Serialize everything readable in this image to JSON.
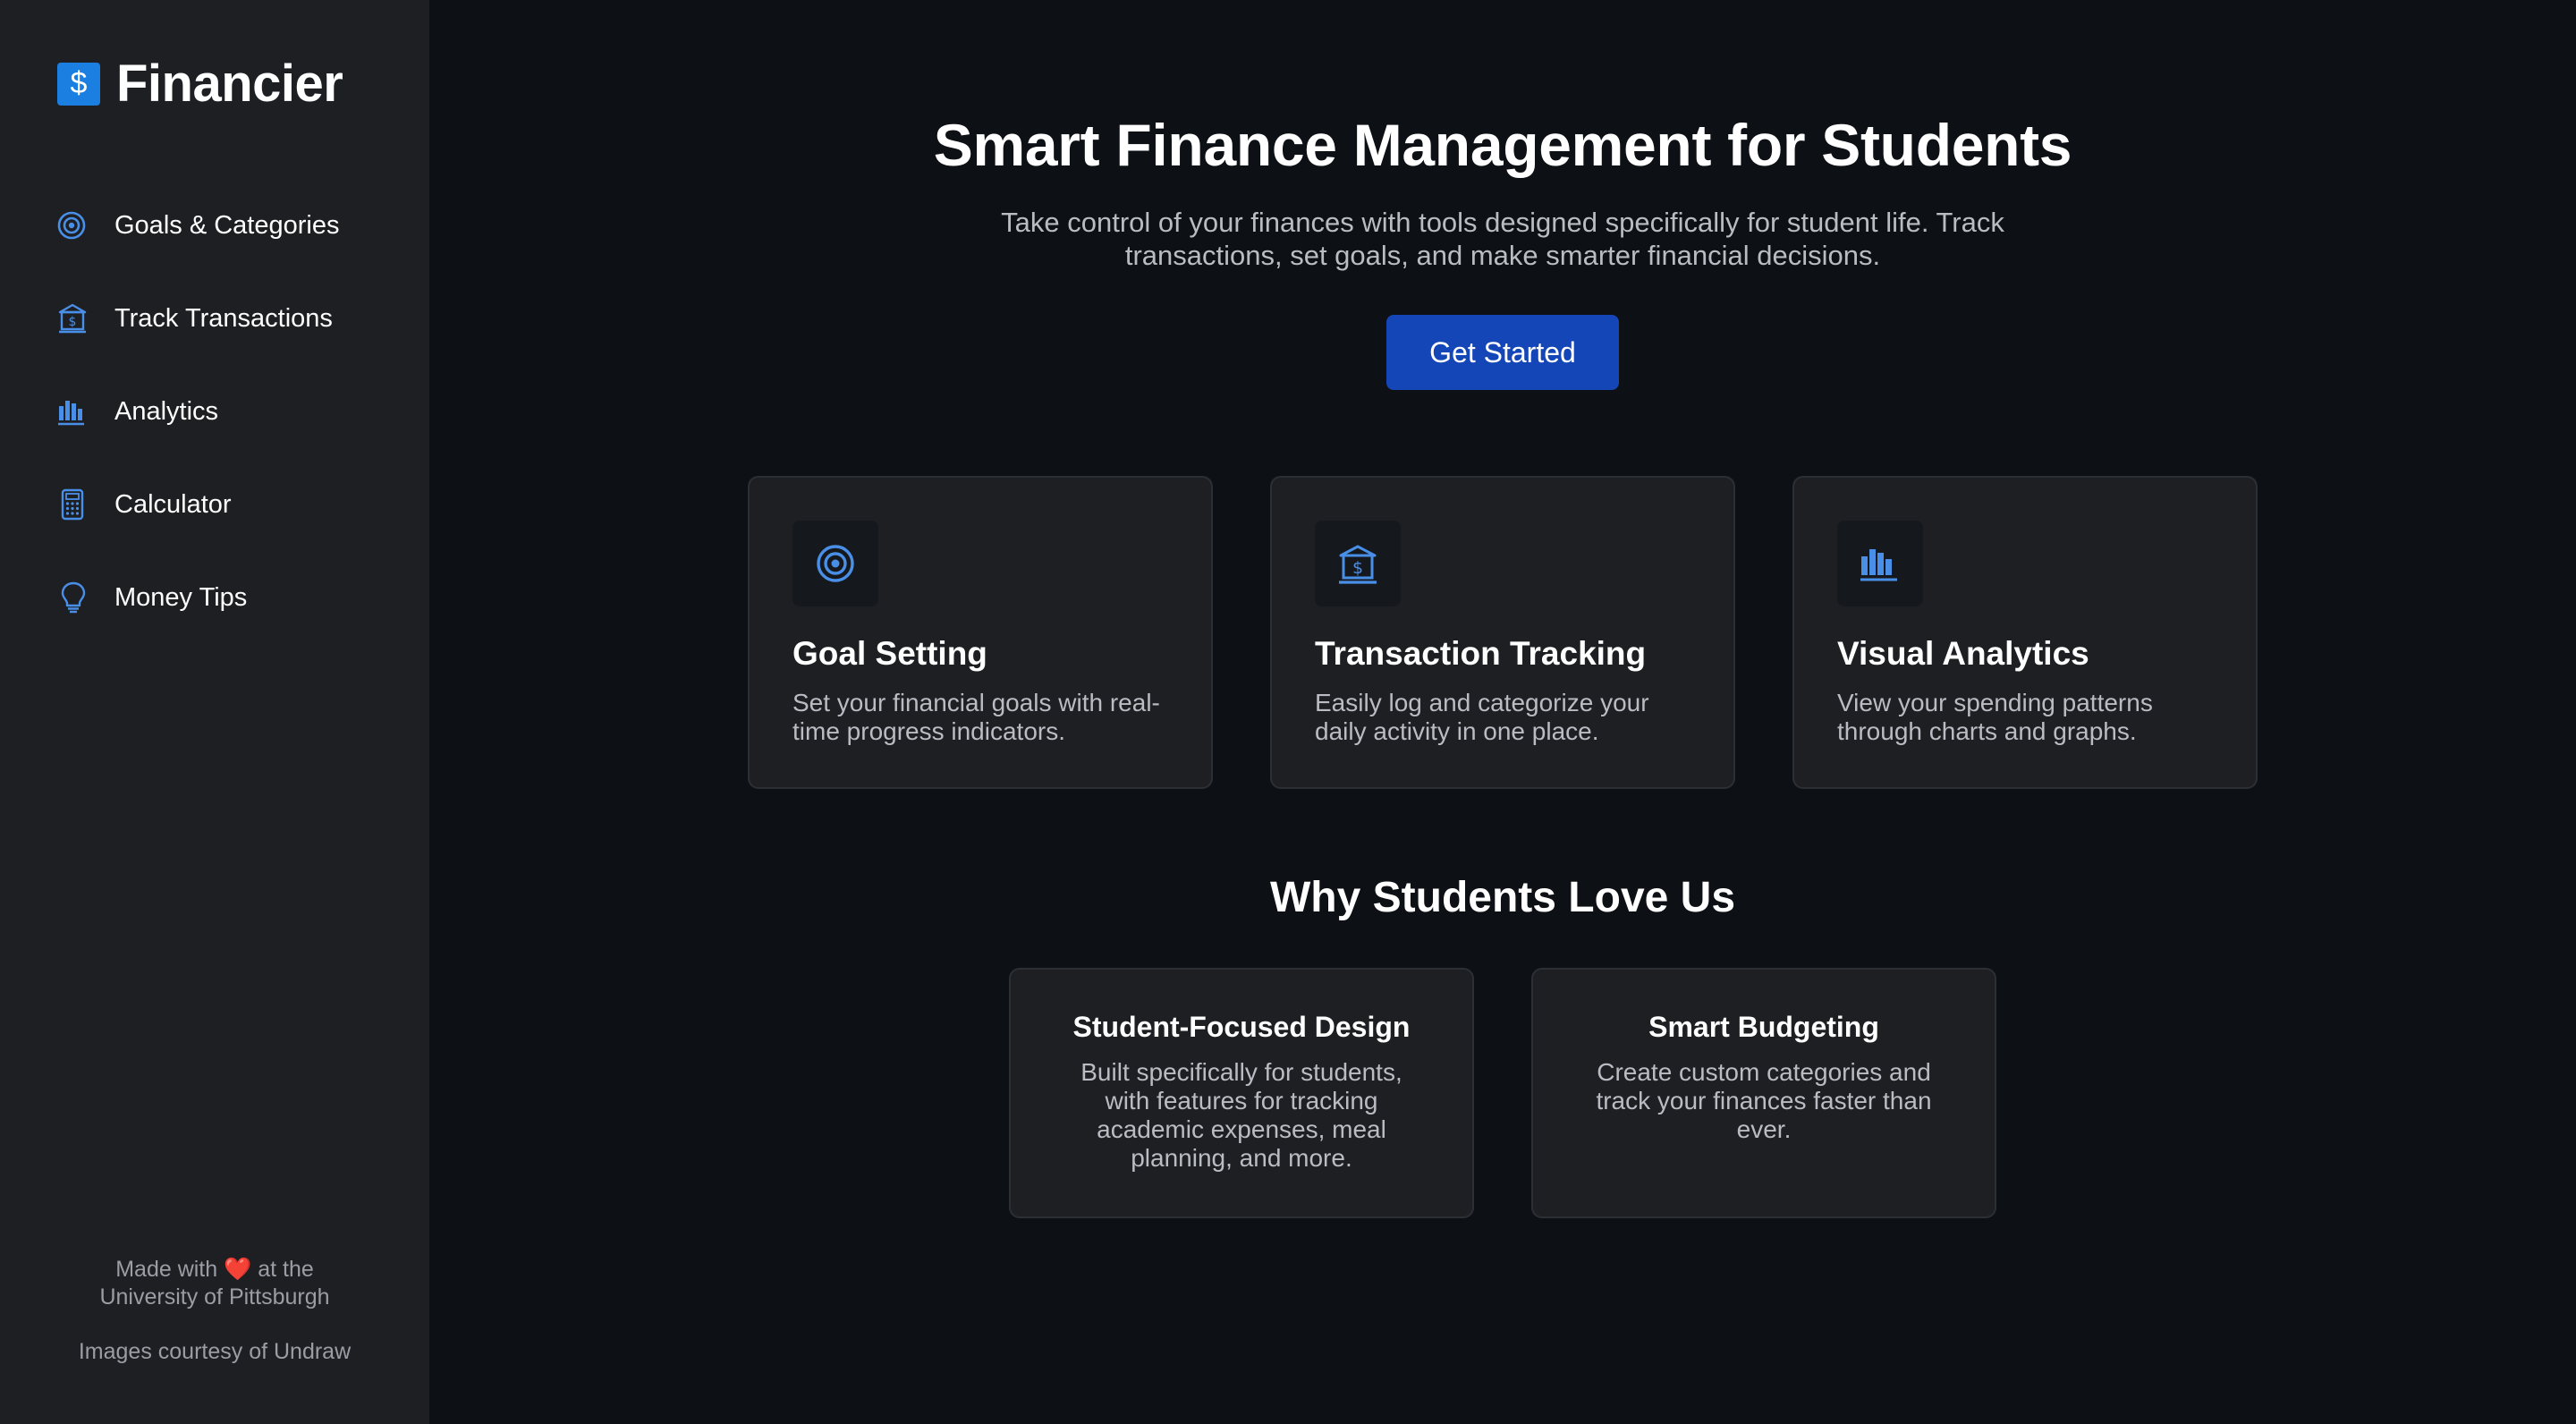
{
  "brand": {
    "name": "Financier",
    "icon": "dollar-icon"
  },
  "colors": {
    "accent": "#1a7fe0",
    "icon_blue": "#4a8fe7",
    "cta": "#1446b8",
    "sidebar_bg": "#1d1f23",
    "main_bg": "#0d1014",
    "card_bg": "#1d1f23",
    "muted_text": "#b9bcc2"
  },
  "sidebar": {
    "items": [
      {
        "label": "Goals & Categories",
        "icon": "target-icon"
      },
      {
        "label": "Track Transactions",
        "icon": "bank-icon"
      },
      {
        "label": "Analytics",
        "icon": "bar-chart-icon"
      },
      {
        "label": "Calculator",
        "icon": "calculator-icon"
      },
      {
        "label": "Money Tips",
        "icon": "lightbulb-icon"
      }
    ],
    "footer": {
      "made_with_prefix": "Made with",
      "heart": "❤️",
      "made_with_suffix": "at the",
      "university": "University of Pittsburgh",
      "credit": "Images courtesy of Undraw"
    }
  },
  "hero": {
    "title": "Smart Finance Management for Students",
    "subtitle": "Take control of your finances with tools designed specifically for student life. Track transactions, set goals, and make smarter financial decisions.",
    "cta_label": "Get Started"
  },
  "features": [
    {
      "title": "Goal Setting",
      "description": "Set your financial goals with real-time progress indicators.",
      "icon": "target-icon"
    },
    {
      "title": "Transaction Tracking",
      "description": "Easily log and categorize your daily activity in one place.",
      "icon": "bank-icon"
    },
    {
      "title": "Visual Analytics",
      "description": "View your spending patterns through charts and graphs.",
      "icon": "bar-chart-icon"
    }
  ],
  "why": {
    "title": "Why Students Love Us",
    "cards": [
      {
        "title": "Student-Focused Design",
        "description": "Built specifically for students, with features for tracking academic expenses, meal planning, and more."
      },
      {
        "title": "Smart Budgeting",
        "description": "Create custom categories and track your finances faster than ever."
      }
    ]
  }
}
